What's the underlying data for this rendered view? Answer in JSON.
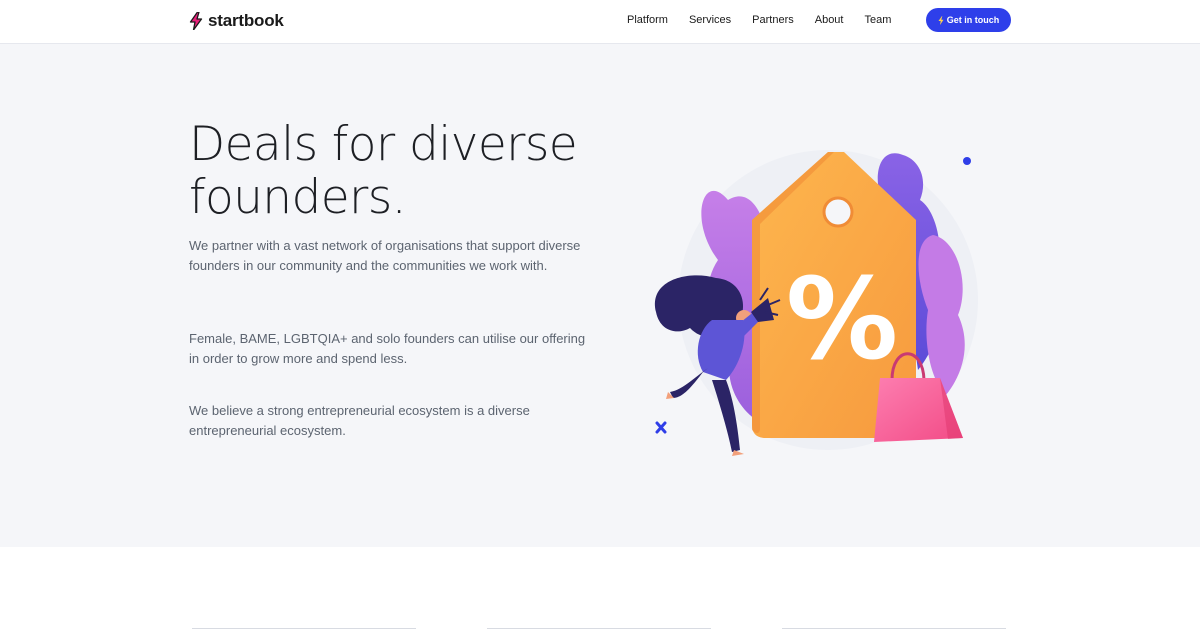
{
  "header": {
    "logo_text": "startbook",
    "nav": [
      "Platform",
      "Services",
      "Partners",
      "About",
      "Team"
    ],
    "cta_label": "Get in touch",
    "cta_icon": "bolt-icon"
  },
  "hero": {
    "headline": "Deals for diverse founders.",
    "paragraphs": [
      "We partner with a vast network of organisations that support diverse founders in our community and the communities we work with.",
      "Female, BAME, LGBTQIA+ and solo founders can utilise our offering in order to grow more and spend less.",
      "We believe a strong entrepreneurial ecosystem is a diverse entrepreneurial ecosystem."
    ],
    "illustration_tag_symbol": "%"
  },
  "colors": {
    "accent": "#2e3fea",
    "logo_bolt": "#e8217a",
    "hero_bg": "#f5f6f9",
    "tag_orange": "#f9a945",
    "plant_purple": "#a56be0",
    "bag_pink": "#f9619a"
  }
}
